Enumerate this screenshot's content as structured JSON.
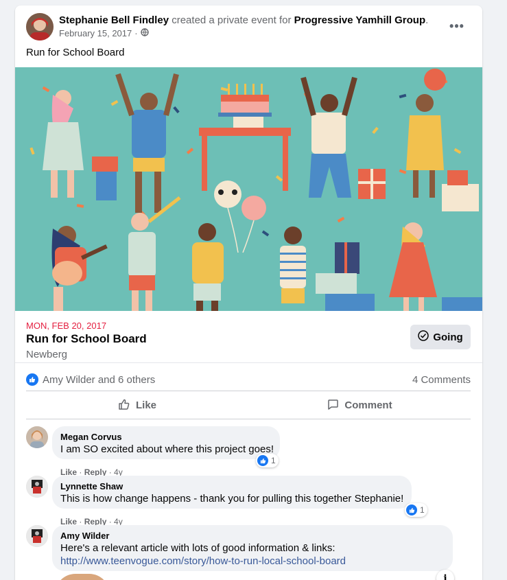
{
  "post": {
    "author": "Stephanie Bell Findley",
    "action_text": "created a private event for",
    "group": "Progressive Yamhill Group",
    "date": "February 15, 2017",
    "privacy_icon": "globe-icon",
    "text": "Run for School Board"
  },
  "event": {
    "date": "MON, FEB 20, 2017",
    "title": "Run for School Board",
    "location": "Newberg",
    "going_label": "Going"
  },
  "stats": {
    "likers": "Amy Wilder and 6 others",
    "comments": "4 Comments"
  },
  "actions": {
    "like": "Like",
    "comment": "Comment"
  },
  "comments": [
    {
      "name": "Megan Corvus",
      "text": "I am SO excited about where this project goes!",
      "like": "Like",
      "reply": "Reply",
      "time": "4y",
      "reactions": "1"
    },
    {
      "name": "Lynnette Shaw",
      "text": "This is how change happens - thank you for pulling this together Stephanie!",
      "like": "Like",
      "reply": "Reply",
      "time": "4y",
      "reactions": "1"
    },
    {
      "name": "Amy Wilder",
      "text": "Here's a relevant article with lots of good information & links:",
      "link": "http://www.teenvogue.com/story/how-to-run-local-school-board"
    }
  ],
  "colors": {
    "accent": "#1877f2",
    "event_date": "#e41e3f",
    "banner_bg": "#6dbfb6",
    "link": "#385898"
  }
}
